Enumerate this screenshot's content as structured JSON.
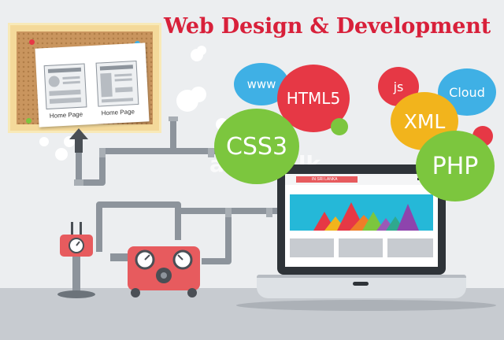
{
  "title": "Web Design & Development",
  "bubbles": {
    "www": "www",
    "html5": "HTML5",
    "css3": "CSS3",
    "js": "js",
    "cloud": "Cloud",
    "xml": "XML",
    "php": "PHP"
  },
  "corkboard": {
    "label_left": "Home Page",
    "label_right": "Home Page"
  },
  "watermark": "adnow.lk",
  "laptop": {
    "banner": "IN SRI LANKA"
  },
  "colors": {
    "title": "#d8203a",
    "css3": "#7cc63e",
    "html5": "#e63845",
    "www": "#3fb0e5",
    "js": "#e63845",
    "cloud": "#3fb0e5",
    "xml": "#f2b41c",
    "php": "#7cc63e"
  }
}
